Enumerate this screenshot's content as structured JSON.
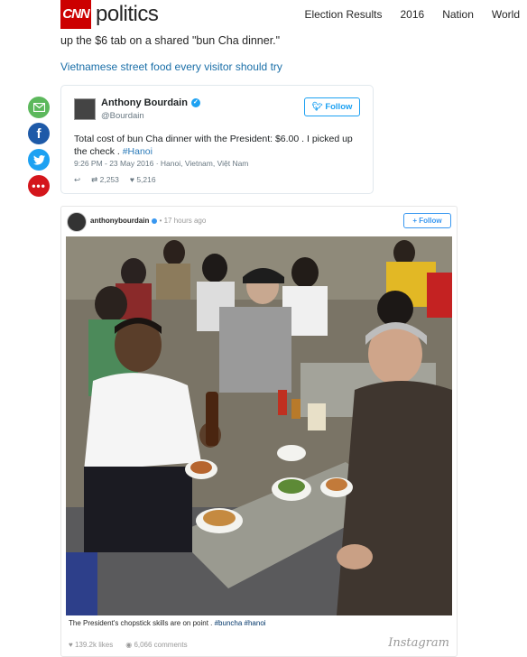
{
  "header": {
    "logo_text": "CNN",
    "section_title": "politics",
    "nav": [
      "Election Results",
      "2016",
      "Nation",
      "World"
    ]
  },
  "article": {
    "intro_text": "up the $6 tab on a shared \"bun Cha dinner.\"",
    "related_link": "Vietnamese street food every visitor should try"
  },
  "share": {
    "email_icon": "envelope-icon",
    "facebook_icon": "facebook-icon",
    "twitter_icon": "twitter-icon",
    "more_icon": "ellipsis-icon"
  },
  "tweet": {
    "name": "Anthony Bourdain",
    "handle": "@Bourdain",
    "follow_label": "Follow",
    "text": "Total cost of bun Cha dinner with the President: $6.00 . I picked up the check . ",
    "hashtag": "#Hanoi",
    "meta": "9:26 PM - 23 May 2016 · Hanoi, Vietnam, Việt Nam",
    "retweets": "2,253",
    "likes": "5,216"
  },
  "instagram": {
    "username": "anthonybourdain",
    "time": "17 hours ago",
    "follow_label": "+ Follow",
    "caption_text": "The President's chopstick skills are on point . ",
    "caption_tags": "#buncha #hanoi",
    "likes": "139.2k likes",
    "comments": "6,066 comments",
    "wordmark": "Instagram"
  },
  "colors": {
    "cnn_red": "#cc0000",
    "link_blue": "#1a6fa8",
    "twitter_blue": "#1da1f2",
    "instagram_blue": "#3897f0"
  }
}
